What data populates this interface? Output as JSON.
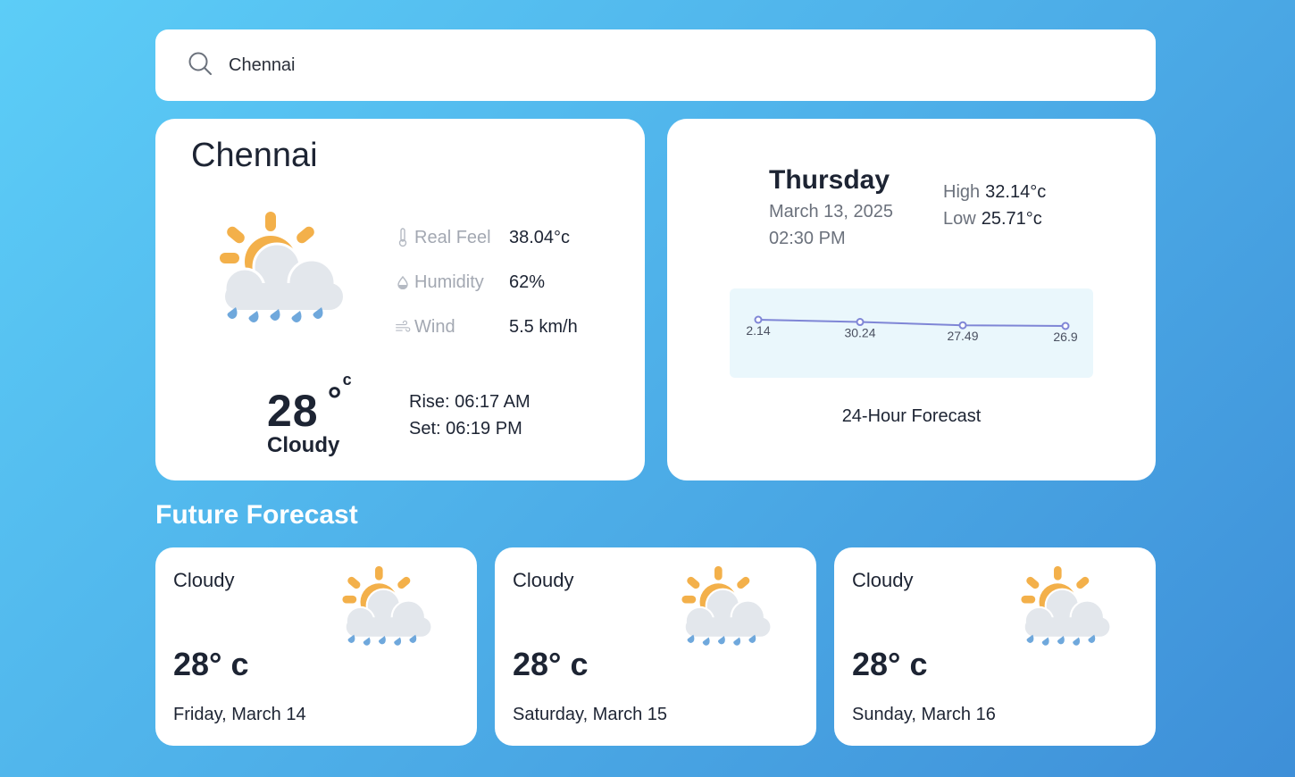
{
  "search": {
    "value": "Chennai",
    "icon": "search-icon"
  },
  "current": {
    "city": "Chennai",
    "icon": "partly-cloudy-rain-icon",
    "stats": [
      {
        "label": "Real Feel",
        "value": "38.04°c",
        "icon": "thermometer-icon"
      },
      {
        "label": "Humidity",
        "value": "62%",
        "icon": "droplet-icon"
      },
      {
        "label": "Wind",
        "value": "5.5 km/h",
        "icon": "wind-icon"
      }
    ],
    "temperature": "28",
    "unit_degree": "°",
    "unit_c": "c",
    "condition": "Cloudy",
    "sunrise": "Rise: 06:17 AM",
    "sunset": "Set: 06:19 PM"
  },
  "today": {
    "day": "Thursday",
    "date": "March 13, 2025",
    "time": "02:30 PM",
    "high_label": "High",
    "high_value": "32.14°c",
    "low_label": "Low",
    "low_value": "25.71°c",
    "chart_caption": "24-Hour Forecast"
  },
  "chart_data": {
    "type": "line",
    "title": "",
    "series": [
      {
        "values": [
          32.14,
          30.24,
          27.49,
          26.9
        ]
      }
    ],
    "data_labels": [
      "2.14",
      "30.24",
      "27.49",
      "26.9"
    ],
    "color": "#7f86d6",
    "background": "#eaf7fc"
  },
  "future": {
    "title": "Future Forecast",
    "cards": [
      {
        "condition": "Cloudy",
        "temp": "28° c",
        "date": "Friday, March 14",
        "icon": "partly-cloudy-rain-icon"
      },
      {
        "condition": "Cloudy",
        "temp": "28° c",
        "date": "Saturday, March 15",
        "icon": "partly-cloudy-rain-icon"
      },
      {
        "condition": "Cloudy",
        "temp": "28° c",
        "date": "Sunday, March 16",
        "icon": "partly-cloudy-rain-icon"
      }
    ]
  },
  "colors": {
    "sun": "#f3b04a",
    "cloud": "#e3e7ec",
    "rain": "#6fa8dc",
    "chart_line": "#7f86d6"
  }
}
